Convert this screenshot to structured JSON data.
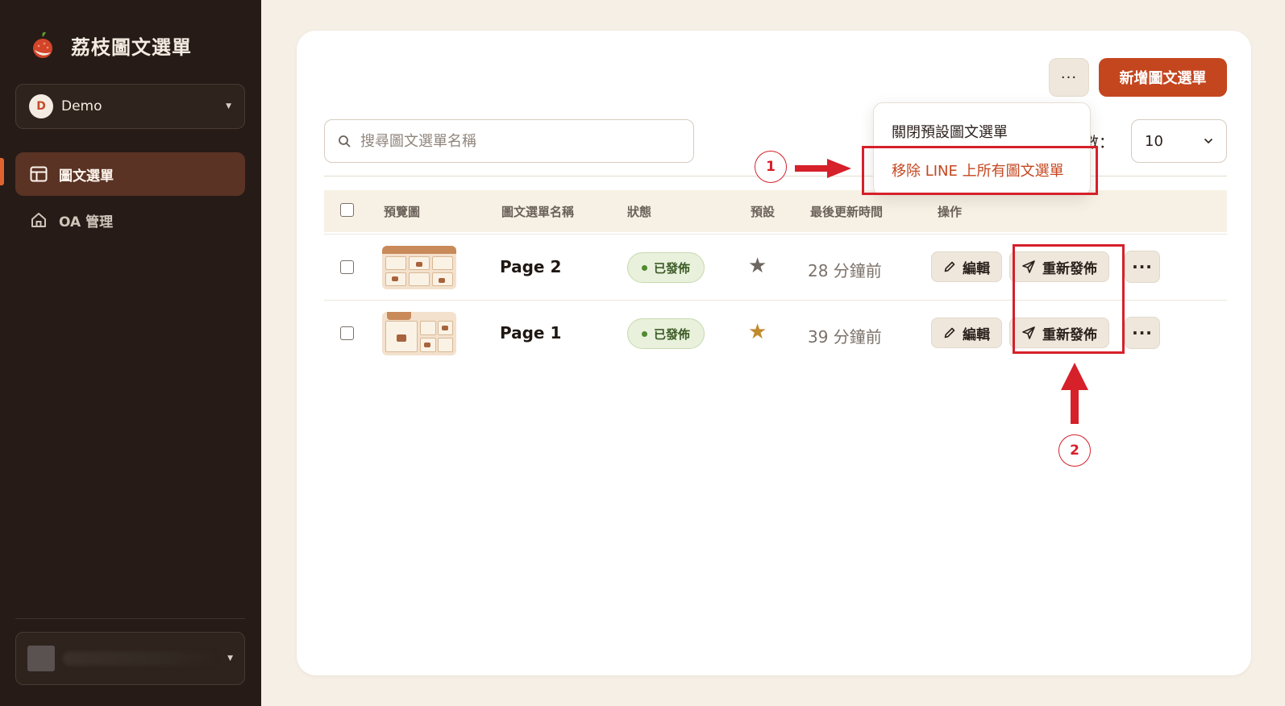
{
  "app": {
    "title": "荔枝圖文選單"
  },
  "workspace": {
    "initial": "D",
    "name": "Demo"
  },
  "nav": [
    {
      "label": "圖文選單",
      "active": true,
      "icon": "layout-icon"
    },
    {
      "label": "OA 管理",
      "active": false,
      "icon": "home-icon"
    }
  ],
  "toolbar": {
    "more_label": "···",
    "add_label": "新增圖文選單"
  },
  "search": {
    "placeholder": "搜尋圖文選單名稱"
  },
  "per_page": {
    "label": "數：",
    "value": "10"
  },
  "dropdown": {
    "items": [
      "關閉預設圖文選單",
      "移除 LINE 上所有圖文選單"
    ]
  },
  "table": {
    "headers": [
      "預覽圖",
      "圖文選單名稱",
      "狀態",
      "預設",
      "最後更新時間",
      "操作"
    ],
    "rows": [
      {
        "name": "Page 2",
        "status": "已發佈",
        "default": false,
        "updated": "28 分鐘前",
        "edit": "編輯",
        "republish": "重新發佈"
      },
      {
        "name": "Page 1",
        "status": "已發佈",
        "default": true,
        "updated": "39 分鐘前",
        "edit": "編輯",
        "republish": "重新發佈"
      }
    ]
  },
  "annotations": {
    "one": "1",
    "two": "2"
  },
  "colors": {
    "accent": "#c4461f",
    "sidebar": "#261b16",
    "annotation": "#d6202a",
    "star_active": "#c08a2e",
    "star_inactive": "#6e6660"
  }
}
